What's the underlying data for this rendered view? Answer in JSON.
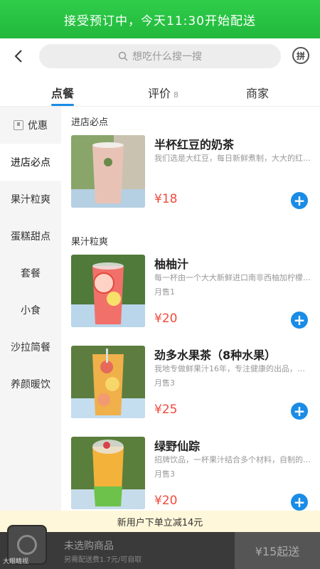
{
  "banner": {
    "text": "接受预订中，今天11:30开始配送"
  },
  "search": {
    "placeholder": "想吃什么搜一搜"
  },
  "header": {
    "pin_label": "拼"
  },
  "tabs": [
    {
      "label": "点餐"
    },
    {
      "label": "评价",
      "count": "8"
    },
    {
      "label": "商家"
    }
  ],
  "sidebar": {
    "items": [
      {
        "label": "优惠"
      },
      {
        "label": "进店必点"
      },
      {
        "label": "果汁粒爽"
      },
      {
        "label": "蛋糕甜点"
      },
      {
        "label": "套餐"
      },
      {
        "label": "小食"
      },
      {
        "label": "沙拉简餐"
      },
      {
        "label": "养颜暖饮"
      }
    ]
  },
  "sections": [
    {
      "title": "进店必点",
      "items": [
        {
          "name": "半杯红豆的奶茶",
          "desc": "我们选是大红豆，每日新鲜煮制，大大的红…",
          "sold": "",
          "price": "¥18"
        }
      ]
    },
    {
      "title": "果汁粒爽",
      "items": [
        {
          "name": "柚柚汁",
          "desc": "每一杯由一个大大新鲜进口南非西柚加柠檬…",
          "sold": "月售1",
          "price": "¥20"
        },
        {
          "name": "劲多水果茶（8种水果）",
          "desc": "我地专做鲜果汁16年，专注健康的出品，…",
          "sold": "月售3",
          "price": "¥25"
        },
        {
          "name": "绿野仙踪",
          "desc": "招牌饮品，一杯果汁结合多个材料，自制的…",
          "sold": "月售3",
          "price": "¥20"
        }
      ]
    }
  ],
  "promo": {
    "text": "新用户下单立减14元"
  },
  "cart": {
    "empty_label": "未选购商品",
    "fee_label": "另需配送费1.7元/可自取",
    "checkout_label": "¥15起送"
  },
  "watermark": "大眼睛视"
}
